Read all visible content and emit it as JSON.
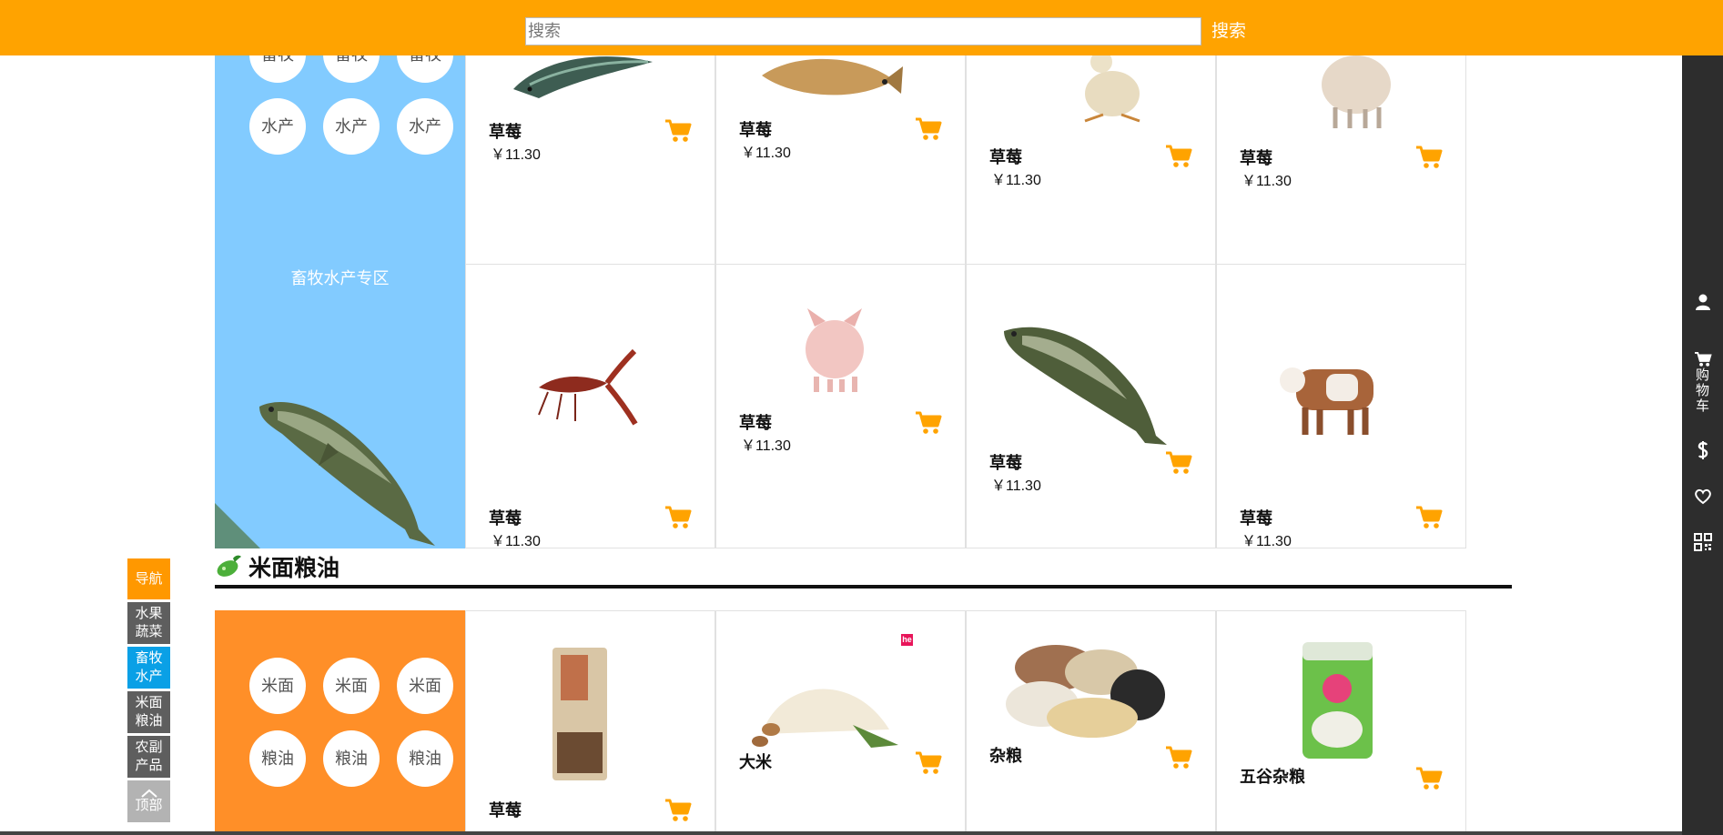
{
  "search": {
    "placeholder": "搜索",
    "button_label": "搜索"
  },
  "right_bar": {
    "cart_label": "购物车"
  },
  "left_nav": {
    "items": [
      {
        "label": "导航"
      },
      {
        "label": "水果蔬菜"
      },
      {
        "label": "畜牧水产"
      },
      {
        "label": "米面粮油"
      },
      {
        "label": "农副产品"
      },
      {
        "label": "顶部"
      }
    ]
  },
  "livestock": {
    "title": "畜牧水产专区",
    "tags": [
      "畜牧",
      "畜牧",
      "畜牧",
      "水产",
      "水产",
      "水产"
    ],
    "products": [
      {
        "name": "草莓",
        "price": "￥11.30"
      },
      {
        "name": "草莓",
        "price": "￥11.30"
      },
      {
        "name": "草莓",
        "price": "￥11.30"
      },
      {
        "name": "草莓",
        "price": "￥11.30"
      },
      {
        "name": "草莓",
        "price": "￥11.30"
      },
      {
        "name": "草莓",
        "price": "￥11.30"
      },
      {
        "name": "草莓",
        "price": "￥11.30"
      },
      {
        "name": "草莓",
        "price": "￥11.30"
      }
    ]
  },
  "grain": {
    "section_title": "米面粮油",
    "tags": [
      "米面",
      "米面",
      "米面",
      "粮油",
      "粮油",
      "粮油"
    ],
    "products": [
      {
        "name": "草莓"
      },
      {
        "name": "大米",
        "badge": "he"
      },
      {
        "name": "杂粮"
      },
      {
        "name": "五谷杂粮"
      }
    ]
  },
  "colors": {
    "topbar": "#ffa300",
    "livestock_panel": "#82cbff",
    "grain_panel": "#ff8f28",
    "cart": "#ffa300",
    "sidebar": "#2d2d2d"
  }
}
